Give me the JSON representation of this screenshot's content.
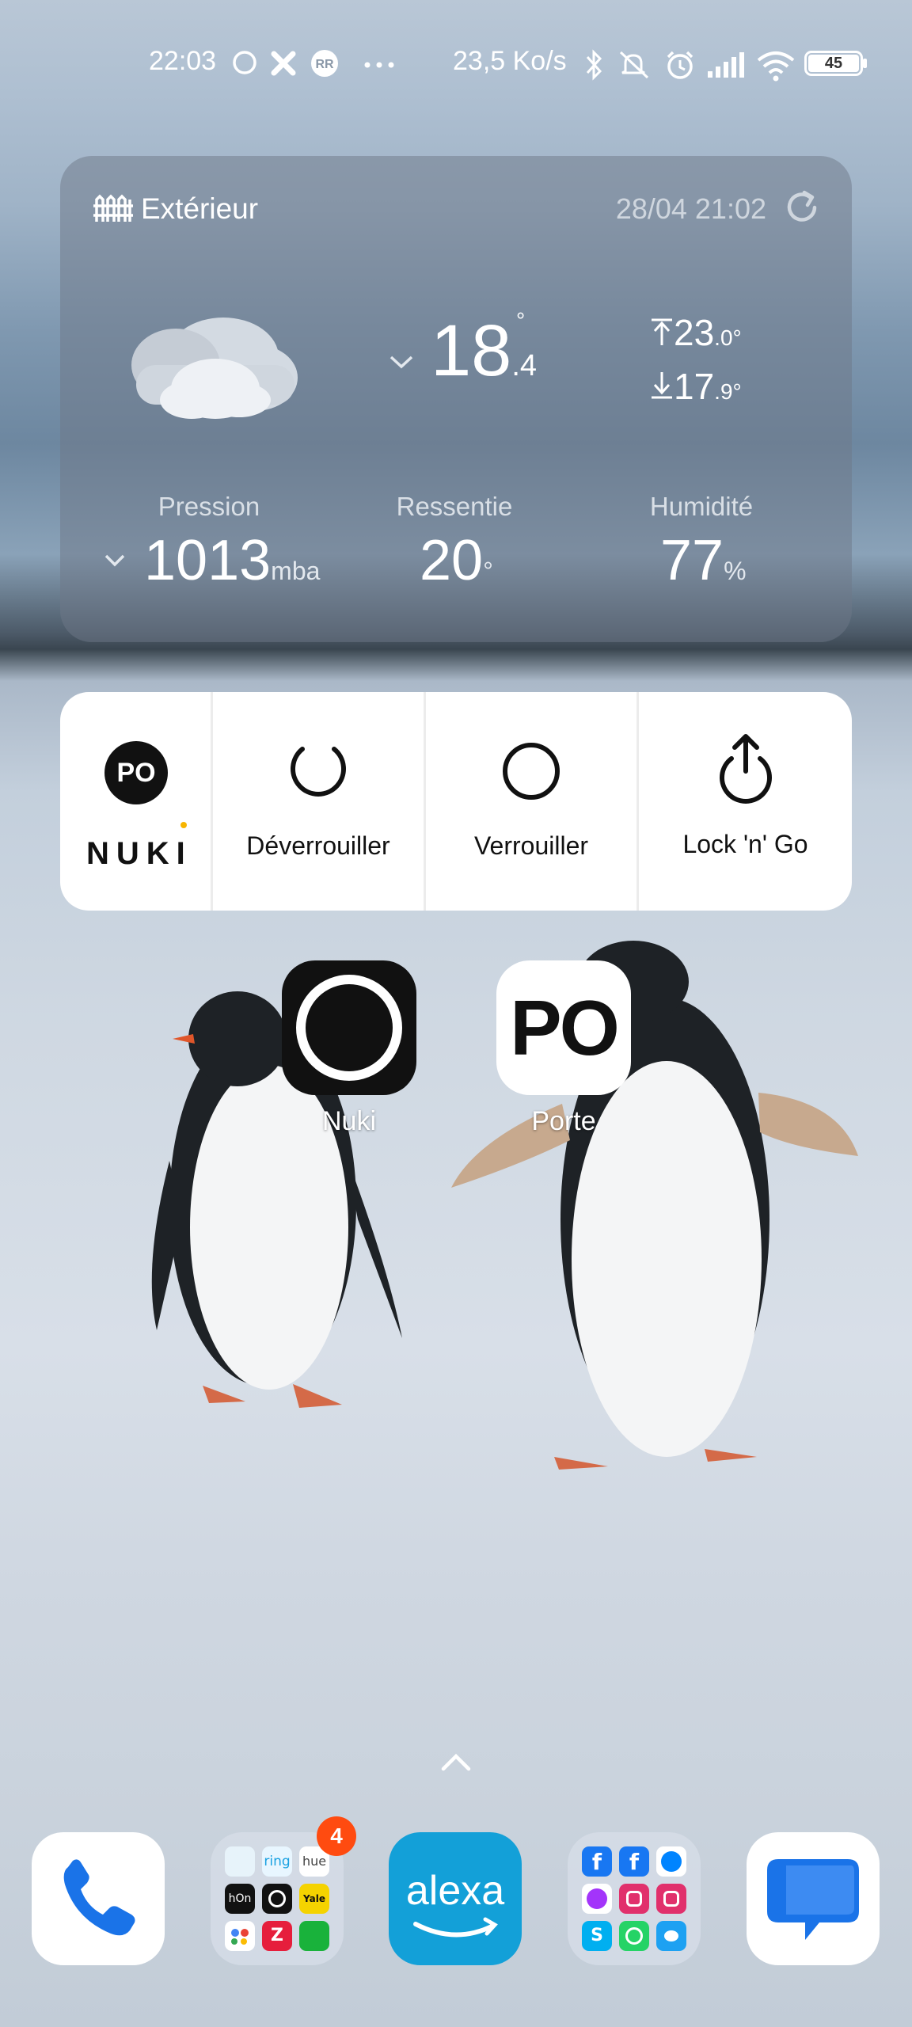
{
  "status_bar": {
    "time": "22:03",
    "net_rate": "23,5 Ko/s",
    "battery": "45",
    "left_icons": [
      "circle-icon",
      "fan-icon",
      "rr-app-icon",
      "more-dots-icon"
    ],
    "right_icons": [
      "bluetooth-icon",
      "mute-icon",
      "alarm-icon",
      "signal-icon",
      "wifi-icon",
      "battery-icon"
    ]
  },
  "weather_widget": {
    "location": "Extérieur",
    "updated": "28/04 21:02",
    "temperature_int": "18",
    "temperature_dec": ".4",
    "degree_symbol": "°",
    "max_int": "23",
    "max_dec": ".0",
    "min_int": "17",
    "min_dec": ".9",
    "pressure_label": "Pression",
    "pressure_value": "1013",
    "pressure_unit": "mba",
    "feels_label": "Ressentie",
    "feels_value": "20",
    "feels_unit": "°",
    "humidity_label": "Humidité",
    "humidity_value": "77",
    "humidity_unit": "%"
  },
  "nuki_widget": {
    "device_badge": "PO",
    "brand": "NUKI",
    "actions": [
      {
        "label": "Déverrouiller",
        "icon": "unlock-arc-icon"
      },
      {
        "label": "Verrouiller",
        "icon": "lock-circle-icon"
      },
      {
        "label": "Lock 'n' Go",
        "icon": "lock-n-go-icon"
      }
    ]
  },
  "apps": [
    {
      "name": "Nuki",
      "icon": "nuki-app-icon"
    },
    {
      "name": "Porte",
      "icon_text": "PO"
    }
  ],
  "dock": {
    "folder_badge": "4",
    "alexa_text": "alexa",
    "items": [
      "phone-app",
      "smart-home-folder",
      "alexa-app",
      "social-folder",
      "messages-app"
    ]
  },
  "colors": {
    "widget_bg": "#6e7887",
    "badge": "#ff4b10",
    "alexa": "#13a0d8",
    "messages": "#1a73e8",
    "phone": "#1a73e8"
  }
}
